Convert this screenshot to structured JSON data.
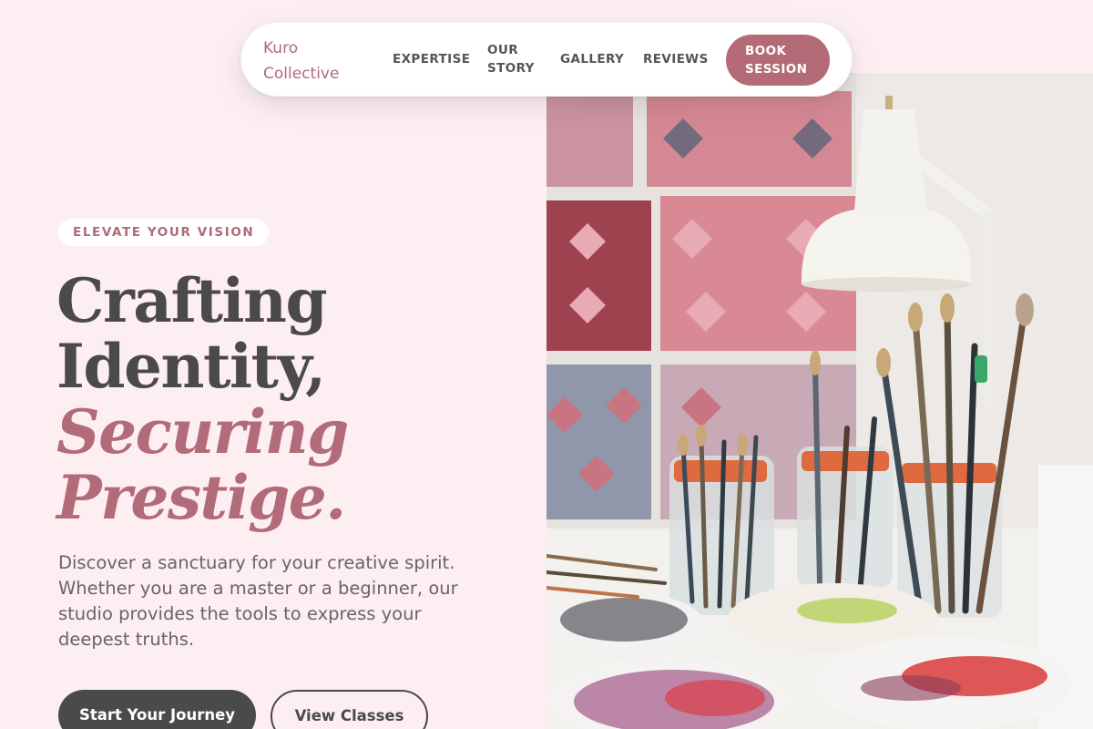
{
  "nav": {
    "logo_line1": "Kuro",
    "logo_line2": "Collective",
    "links": [
      {
        "label": "EXPERTISE"
      },
      {
        "label_line1": "OUR",
        "label_line2": "STORY"
      },
      {
        "label": "GALLERY"
      },
      {
        "label": "REVIEWS"
      }
    ],
    "cta_line1": "BOOK",
    "cta_line2": "SESSION"
  },
  "hero": {
    "eyebrow": "ELEVATE YOUR VISION",
    "headline": {
      "line1": "Crafting",
      "line2": "Identity,",
      "line3": "Securing",
      "line4": "Prestige."
    },
    "lead": "Discover a sanctuary for your creative spirit. Whether you are a master or a beginner, our studio provides the tools to express your deepest truths.",
    "primary_button": "Start Your Journey",
    "secondary_button": "View Classes"
  },
  "colors": {
    "background": "#fdeef2",
    "accent": "#b26b78",
    "dark": "#4a4a4a",
    "white": "#ffffff"
  },
  "icons": {
    "hero_image": "art-studio-brushes-photo"
  }
}
